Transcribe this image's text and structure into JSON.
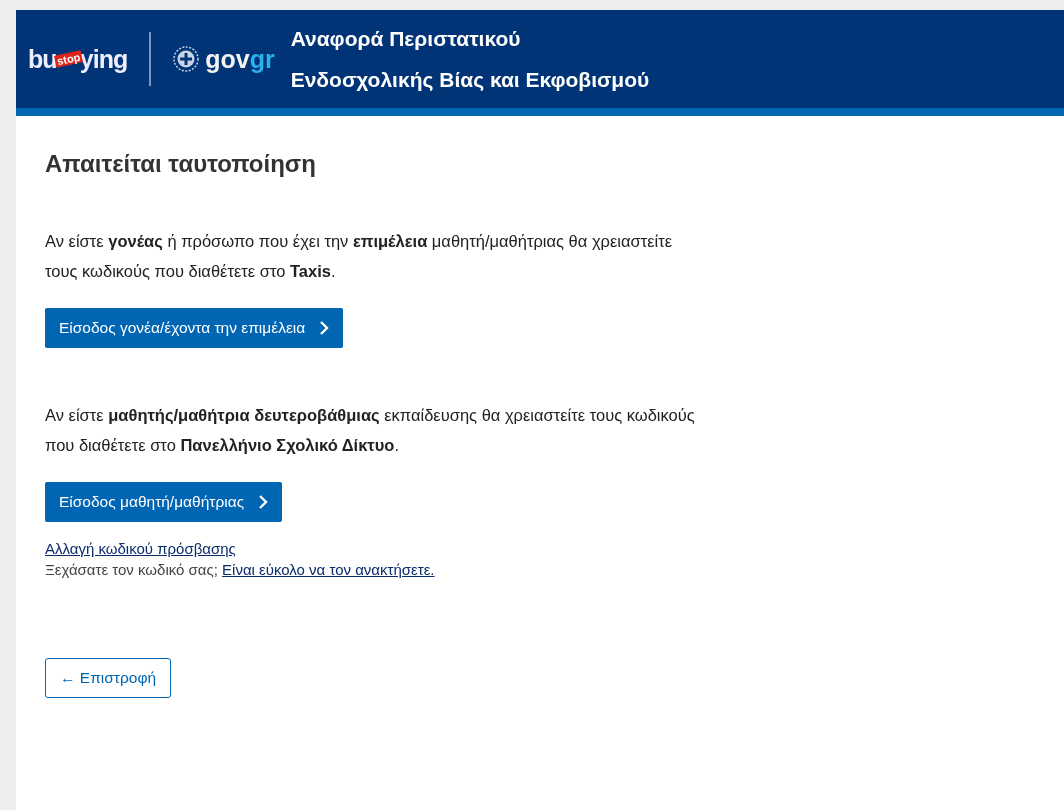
{
  "header": {
    "logo_parts": [
      "bu",
      "stop",
      "ying"
    ],
    "gov_logo": {
      "gov": "gov",
      "gr": "gr"
    },
    "title_lines": [
      "Αναφορά Περιστατικού",
      "Ενδοσχολικής Βίας και Εκφοβισμού"
    ]
  },
  "heading": "Απαιτείται ταυτοποίηση",
  "sections": [
    {
      "text": "Αν είστε **γονέας** ή πρόσωπο που έχει την **επιμέλεια** μαθητή/μαθήτριας θα χρειαστείτε τους κωδικούς που διαθέτετε στο **Taxis**.",
      "button": "Είσοδος γονέα/έχοντα την επιμέλεια"
    },
    {
      "text": "Αν είστε **μαθητής/μαθήτρια δευτεροβάθμιας** εκπαίδευσης θα χρειαστείτε τους κωδικούς που διαθέτετε στο **Πανελλήνιο Σχολικό Δίκτυο**.",
      "button": "Είσοδος μαθητή/μαθήτριας"
    }
  ],
  "change_password_link": "Αλλαγή κωδικού πρόσβασης",
  "forgot": {
    "text": "Ξεχάσατε τον κωδικό σας;",
    "link": "Είναι εύκολο να τον ανακτήσετε."
  },
  "back_button": "← Επιστροφή"
}
